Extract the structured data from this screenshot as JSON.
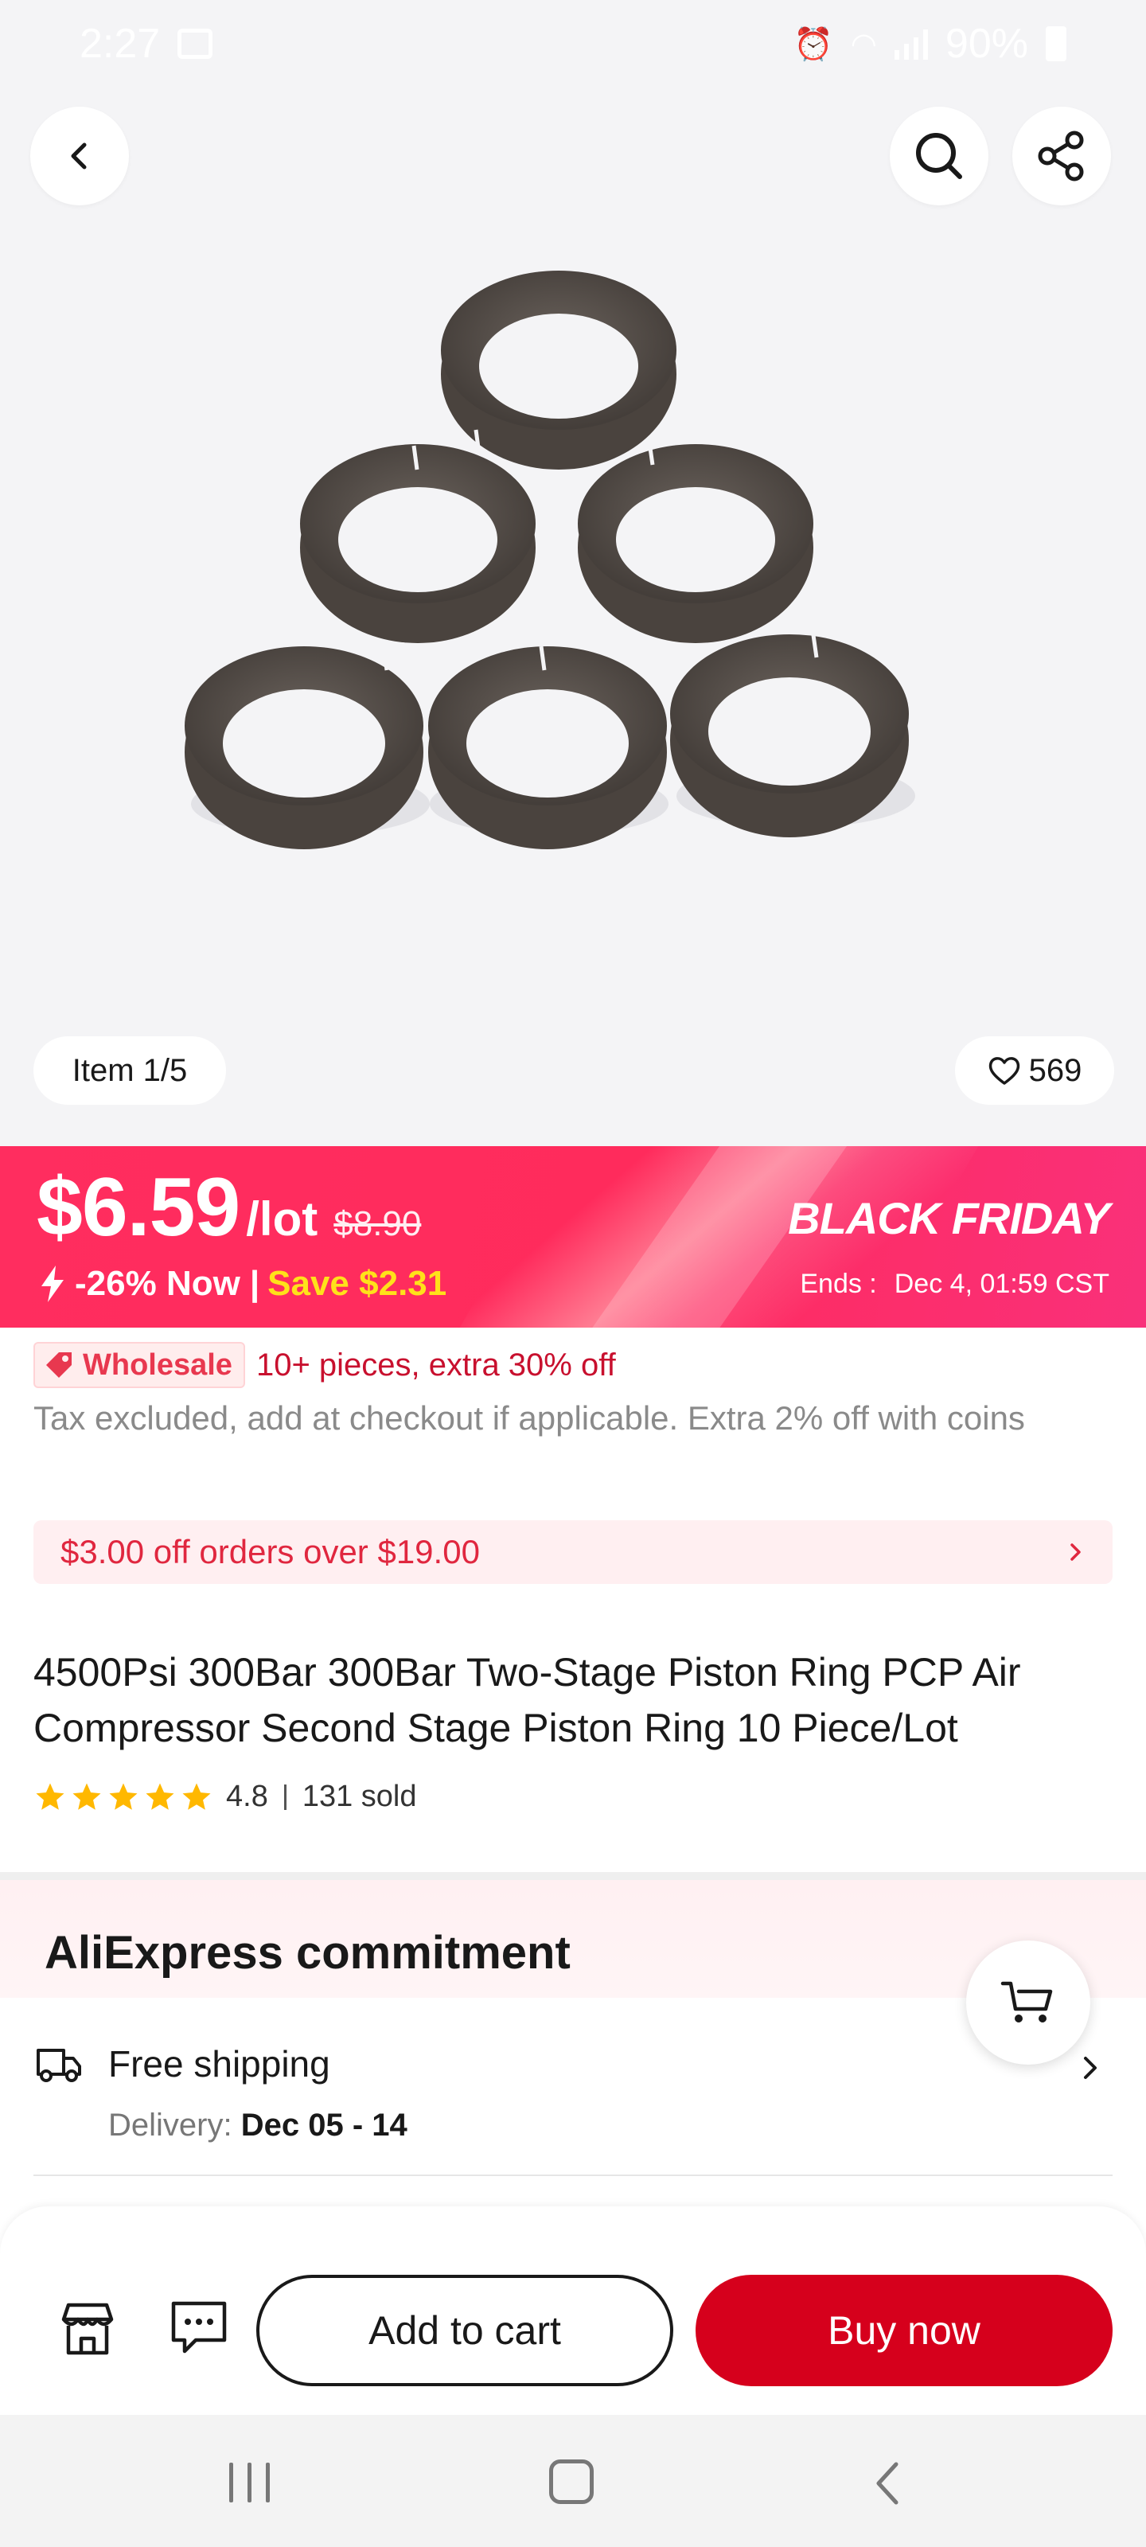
{
  "status_bar": {
    "time": "2:27",
    "battery": "90%"
  },
  "gallery": {
    "counter": "Item 1/5",
    "favorites": "569"
  },
  "price": {
    "current": "$6.59",
    "unit": "/lot",
    "original": "$8.90",
    "discount": "-26% Now",
    "separator": "|",
    "save": "Save $2.31"
  },
  "promo": {
    "title": "BLACK FRIDAY",
    "ends_label": "Ends :",
    "ends_value": "Dec 4, 01:59 CST"
  },
  "wholesale": {
    "badge": "Wholesale",
    "text": "10+ pieces, extra 30% off"
  },
  "tax_note": "Tax excluded, add at checkout if applicable. Extra 2% off with coins",
  "coupon": {
    "text": "$3.00 off orders over $19.00"
  },
  "product": {
    "title": "4500Psi 300Bar 300Bar Two-Stage Piston Ring PCP Air Compressor Second Stage Piston Ring 10 Piece/Lot",
    "rating": "4.8",
    "stars": 5,
    "sold": "131 sold"
  },
  "commitment": {
    "title": "AliExpress commitment",
    "shipping_title": "Free shipping",
    "delivery_label": "Delivery:",
    "delivery_dates": "Dec 05 - 14"
  },
  "actions": {
    "add_to_cart": "Add to cart",
    "buy_now": "Buy now"
  },
  "colors": {
    "accent_red": "#d6001c",
    "banner_pink": "#ff2d5f",
    "save_yellow": "#ffe11a",
    "star": "#ffb800"
  },
  "icons": [
    "back-arrow-icon",
    "search-icon",
    "share-icon",
    "heart-icon",
    "flash-icon",
    "wholesale-tag-icon",
    "chevron-right-icon",
    "star-icon",
    "truck-icon",
    "cart-icon",
    "store-icon",
    "chat-icon"
  ]
}
